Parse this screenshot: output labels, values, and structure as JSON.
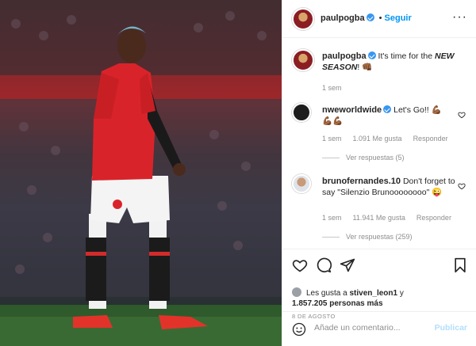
{
  "post": {
    "author": "paulpogba",
    "follow_label": "Seguir",
    "more_icon": "more-options-icon",
    "photo_description_icon": "player-photo",
    "caption": {
      "username": "paulpogba",
      "text_plain": "It's time for the ",
      "text_bold": "NEW SEASON",
      "text_after": "! ",
      "emoji": "👊🏾",
      "time": "1 sem"
    },
    "comments": [
      {
        "username": "nweworldwide",
        "text": "Let's Go!! 💪🏾",
        "text_line2": "💪🏾💪🏾",
        "time": "1 sem",
        "likes": "1.091 Me gusta",
        "reply_label": "Responder",
        "replies_label": "Ver respuestas (5)"
      },
      {
        "username": "brunofernandes.10",
        "text": "Don't forget to say \"Silenzio Brunoooooooo\" 😜",
        "time": "1 sem",
        "likes": "11.941 Me gusta",
        "reply_label": "Responder",
        "replies_label": "Ver respuestas (259)"
      }
    ],
    "likes_line": {
      "prefix": "Les gusta a ",
      "user": "stiven_leon1",
      "mid": " y ",
      "count": "1.857.205 personas más"
    },
    "date": "8 DE AGOSTO",
    "add_comment_placeholder": "Añade un comentario...",
    "publish_label": "Publicar"
  },
  "colors": {
    "accent": "#0095f6",
    "verified": "#3897f0",
    "muted": "#8e8e8e",
    "publish_disabled": "#b2dffc"
  }
}
